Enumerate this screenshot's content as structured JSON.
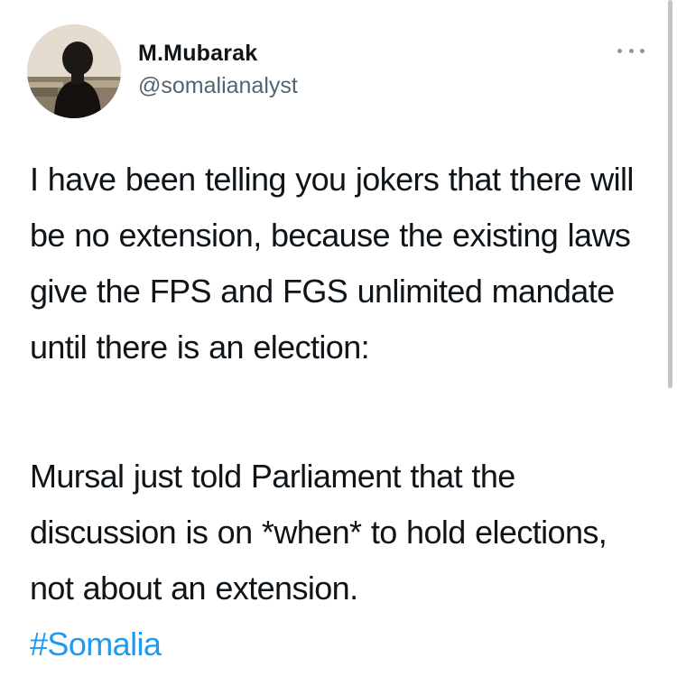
{
  "tweet": {
    "author_name": "M.Mubarak",
    "author_handle": "@somalianalyst",
    "paragraphs": [
      "I have been telling you jokers that there will be no extension, because the existing laws give the FPS and FGS unlimited mandate until there is an election:",
      "Mursal just told Parliament that the discussion is on *when* to hold elections, not about an extension."
    ],
    "hashtag": "#Somalia"
  },
  "colors": {
    "text": "#0f1419",
    "secondary_text": "#536471",
    "hashtag": "#1d9bf0",
    "background": "#ffffff"
  },
  "icons": {
    "more_options": "more-horizontal-icon"
  }
}
